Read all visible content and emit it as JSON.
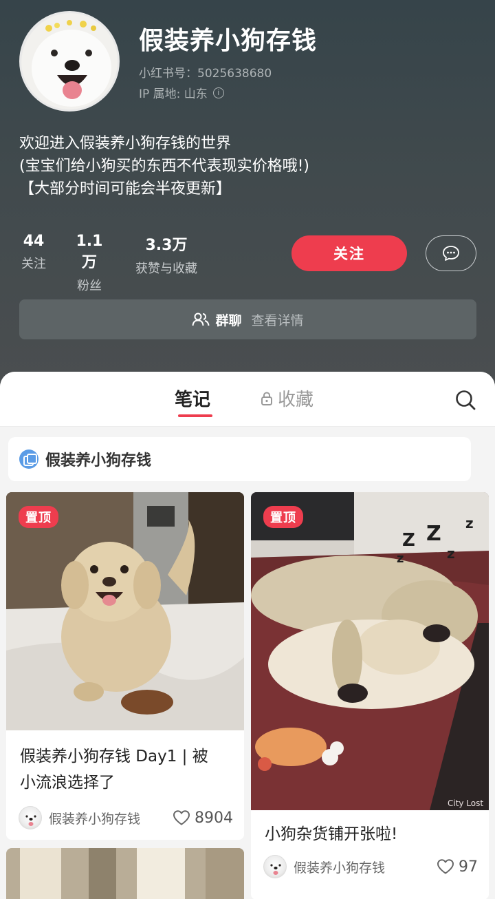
{
  "profile": {
    "name": "假装养小狗存钱",
    "redbook_id": "小红书号：5025638680",
    "ip_location": "IP 属地: 山东",
    "bio": [
      "欢迎进入假装养小狗存钱的世界",
      "(宝宝们给小狗买的东西不代表现实价格哦!)",
      "【大部分时间可能会半夜更新】"
    ]
  },
  "stats": [
    {
      "value": "44",
      "label": "关注"
    },
    {
      "value": "1.1万",
      "label": "粉丝"
    },
    {
      "value": "3.3万",
      "label": "获赞与收藏"
    }
  ],
  "actions": {
    "follow": "关注"
  },
  "group_chat": {
    "title": "群聊",
    "detail": "查看详情"
  },
  "tabs": {
    "notes": "笔记",
    "favorites": "收藏"
  },
  "collection": {
    "label": "假装养小狗存钱"
  },
  "notes": [
    {
      "badge": "置顶",
      "title_line1": "假装养小狗存钱 Day1 | 被",
      "title_line2": "小流浪选择了",
      "author": "假装养小狗存钱",
      "likes": "8904"
    },
    {
      "badge": "置顶",
      "title_line1": "小狗杂货铺开张啦!",
      "author": "假装养小狗存钱",
      "likes": "97",
      "watermark": "City Lost"
    }
  ],
  "colors": {
    "accent": "#ee3d4e",
    "header_bg": "#3f484b",
    "link_blue": "#5b9ce6"
  },
  "icons": {
    "info": "info-circle-icon",
    "message": "chat-bubble-icon",
    "group": "group-users-icon",
    "lock": "lock-icon",
    "search": "search-icon",
    "heart": "heart-icon"
  }
}
